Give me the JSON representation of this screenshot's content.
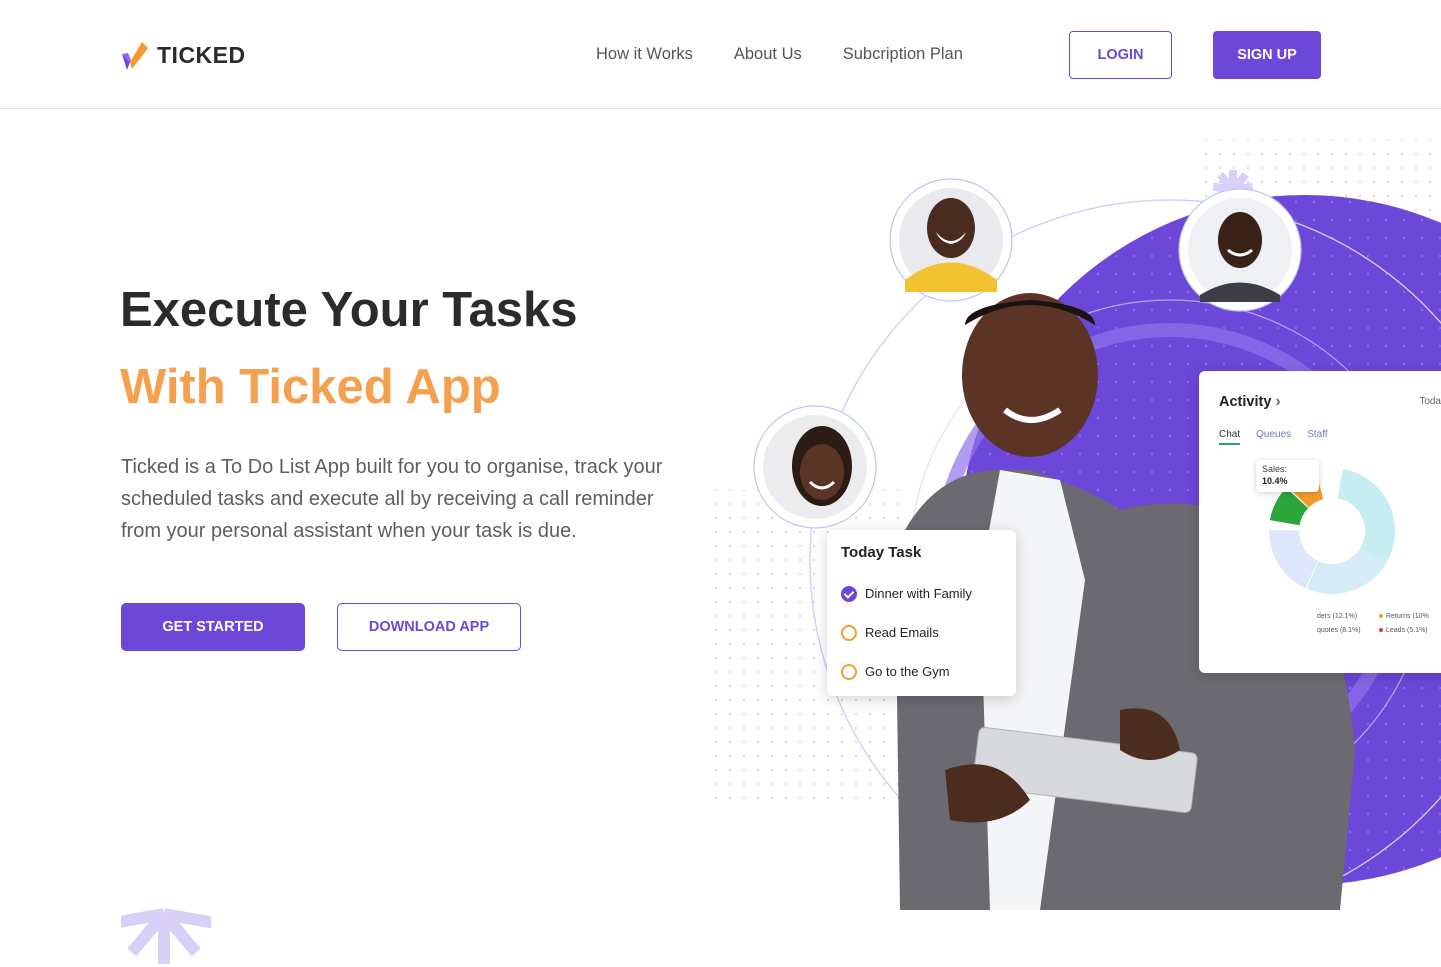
{
  "brand": {
    "name": "TICKED",
    "accent": "#6c47d8",
    "orange": "#f4a04f"
  },
  "nav": {
    "links": [
      "How it Works",
      "About Us",
      "Subcription Plan"
    ],
    "login_label": "LOGIN",
    "signup_label": "SIGN UP"
  },
  "hero": {
    "title_line1": "Execute Your Tasks",
    "title_line2": "With Ticked App",
    "description": "Ticked is a To Do List App built for you to organise, track your scheduled tasks and execute all by receiving a call reminder from your personal assistant when your task is due.",
    "cta_primary": "GET STARTED",
    "cta_secondary": "DOWNLOAD APP"
  },
  "today_task": {
    "title": "Today Task",
    "items": [
      {
        "label": "Dinner with Family",
        "done": true
      },
      {
        "label": "Read Emails",
        "done": false
      },
      {
        "label": "Go to the Gym",
        "done": false
      }
    ]
  },
  "activity": {
    "title": "Activity",
    "today": "Toda",
    "tabs": [
      "Chat",
      "Queues",
      "Staff"
    ],
    "active_tab": "Chat",
    "tooltip_label": "Sales:",
    "tooltip_value": "10.4%",
    "legend": [
      "ders (12.1%)",
      "quotes (8.1%)",
      "Returns (10%",
      "Leads (5.1%)"
    ]
  }
}
